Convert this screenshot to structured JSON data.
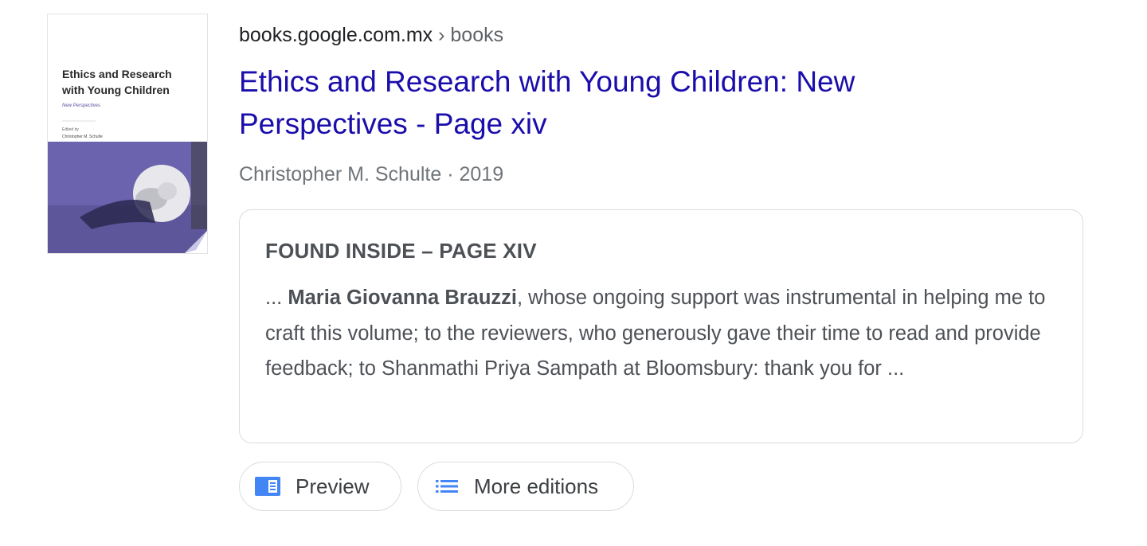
{
  "thumbnail": {
    "cover_title_line1": "Ethics and Research",
    "cover_title_line2": "with Young Children",
    "cover_subtitle": "New Perspectives",
    "cover_editor_label": "Edited by",
    "cover_editor_name": "Christopher M. Schulte",
    "cover_color": "#6b63ad"
  },
  "result": {
    "domain": "books.google.com.mx",
    "separator": " › ",
    "breadcrumb": "books",
    "title_line1": "Ethics and Research with Young Children: New",
    "title_line2": "Perspectives - Page xiv",
    "author": "Christopher M. Schulte",
    "meta_separator": " · ",
    "year": "2019"
  },
  "snippet": {
    "heading": "FOUND INSIDE – PAGE XIV",
    "prefix": "... ",
    "highlight": "Maria Giovanna Brauzzi",
    "body": ", whose ongoing support was instrumental in helping me to craft this volume; to the reviewers, who generously gave their time to read and provide feedback; to Shanmathi Priya Sampath at Bloomsbury: thank you for ..."
  },
  "actions": {
    "preview_label": "Preview",
    "preview_icon": "book-preview-icon",
    "editions_label": "More editions",
    "editions_icon": "list-icon"
  },
  "colors": {
    "link": "#1a0dab",
    "icon_blue": "#4285f4",
    "text_secondary": "#70757a",
    "border": "#dadce0"
  }
}
